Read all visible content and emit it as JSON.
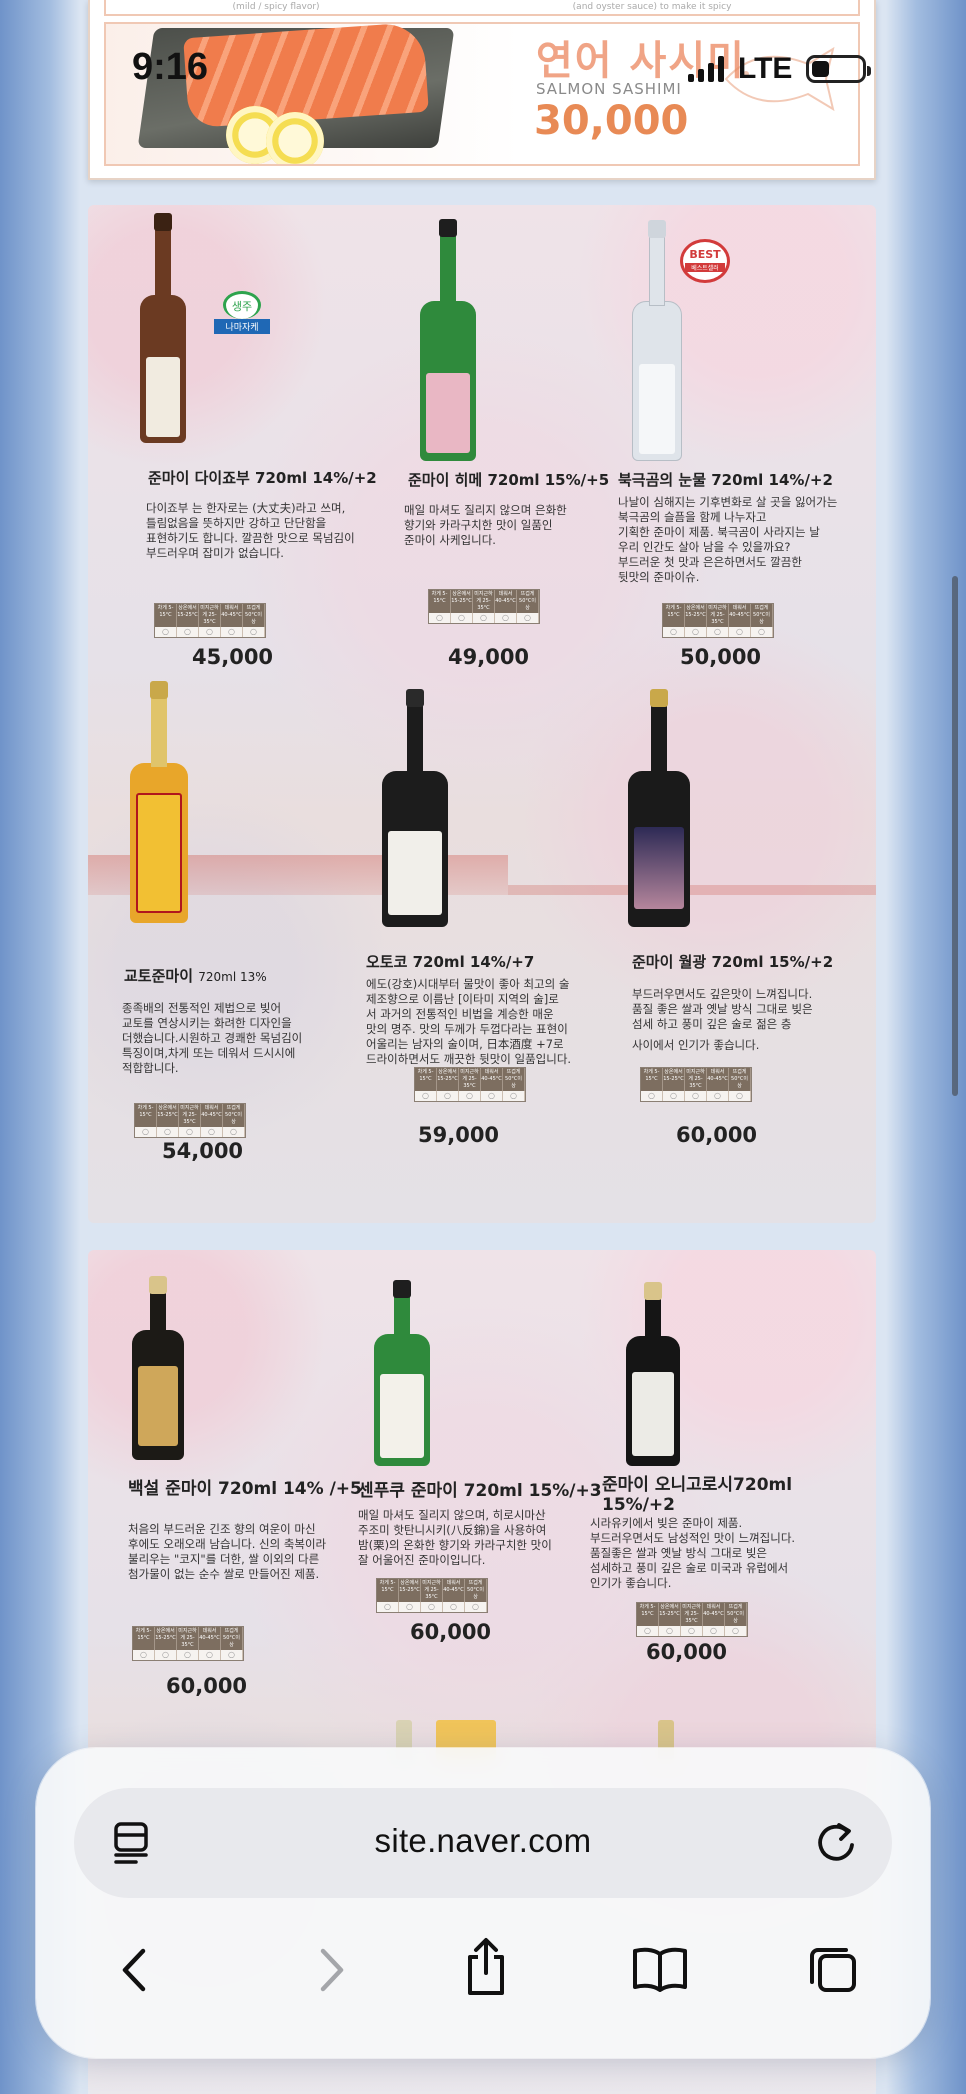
{
  "status_bar": {
    "time": "9:16",
    "network": "LTE",
    "battery_level": 0.34
  },
  "top_banner": {
    "prev_strip_left": "(mild / spicy flavor)",
    "prev_strip_right": "(and oyster sauce) to make it spicy",
    "title_kr": "연어 사시미",
    "title_en": "SALMON SASHIMI",
    "price": "30,000"
  },
  "temperature_headers": [
    "차게 5-15°C",
    "상온에서 15-25°C",
    "미지근하게 25-35°C",
    "데워서 40-45°C",
    "뜨겁게 50°C이상"
  ],
  "panel1": {
    "products": [
      {
        "name": "준마이 다이죠부 720ml 14%/+2",
        "desc": [
          "다이죠부 는 한자로는 (大丈夫)라고 쓰며,",
          "틀림없음을 뜻하지만 강하고 단단함을",
          "표현하기도 합니다. 깔끔한 맛으로 목넘김이",
          "부드러우며 잡미가 없습니다."
        ],
        "price": "45,000",
        "badge": "생주",
        "badge_ribbon": "나마자케",
        "bottle_color": "#6b3a22"
      },
      {
        "name": "준마이 히메 720ml 15%/+5",
        "desc": [
          "매일 마셔도 질리지 않으며 은화한",
          "향기와 카라구치한 맛이 일품인",
          "준마이 사케입니다."
        ],
        "price": "49,000",
        "bottle_color": "#2f8a3c"
      },
      {
        "name": "북극곰의 눈물 720ml 14%/+2",
        "desc": [
          "나날이 심해지는 기후변화로 살 곳을 잃어가는",
          "북극곰의 슬픔을 함께 나누자고",
          "기획한 준마이 제품. 북극곰이 사라지는 날",
          "우리 인간도 살아 남을 수 있을까요?",
          "부드러운 첫 맛과 은은하면서도 깔끔한",
          "뒷맛의 준마이슈."
        ],
        "price": "50,000",
        "badge": "BEST",
        "badge_ribbon": "베스트셀러",
        "bottle_color": "#dfe4ea"
      },
      {
        "name": "교토준마이",
        "name_small": "720ml 13%",
        "desc": [
          "종족배의 전통적인 제법으로 빚어",
          "교토를 연상시키는 화려한 디자인을",
          "더했습니다.시원하고 경쾌한 목넘김이",
          "특징이며,차게 또는 데워서 드시시에",
          "적합합니다."
        ],
        "price": "54,000",
        "bottle_color": "#e8a62a"
      },
      {
        "name": "오토코 720ml 14%/+7",
        "desc": [
          "에도(강호)시대부터 물맛이 좋아 최고의 술",
          "제조향으로 이름난 [이타미 지역의 술]로",
          "서 과거의 전통적인 비법을 계승한 매운",
          "맛의 명주. 맛의 두께가 두껍다라는 표현이",
          "어울리는 남자의 술이며, 日本酒度 +7로",
          "드라이하면서도 깨끗한 뒷맛이 일품입니다."
        ],
        "price": "59,000",
        "bottle_color": "#1c1c1c"
      },
      {
        "name": "준마이 월광 720ml 15%/+2",
        "desc": [
          "부드러우면서도 깊은맛이 느껴집니다.",
          "품질 좋은 쌀과 옛날 방식 그대로 빚은",
          "섬세 하고 풍미 깊은 술로 젊은 층",
          "",
          "사이에서 인기가 좋습니다."
        ],
        "price": "60,000",
        "bottle_color": "#1a1a1a"
      }
    ]
  },
  "panel2": {
    "products": [
      {
        "name": "백설 준마이 720ml 14% /+5",
        "desc": [
          "처음의 부드러운 긴조 향의 여운이 마신",
          "후에도 오래오래 남습니다. 신의 축복이라",
          "불리우는 \"코지\"를 더한, 쌀 이외의 다른",
          "첨가물이 없는 순수 쌀로 만들어진 제품."
        ],
        "price": "60,000",
        "bottle_color": "#1c1a16"
      },
      {
        "name": "센푸쿠 준마이 720ml 15%/+3",
        "desc": [
          "매일 마셔도 질리지 않으며, 히로시마산",
          "주조미 핫탄니시키(八反錦)을 사용하여",
          "밤(栗)의 온화한 향기와 카라구치한 맛이",
          "잘 어울어진 준마이입니다."
        ],
        "price": "60,000",
        "bottle_color": "#2f8a3c"
      },
      {
        "name": "준마이 오니고로시720ml 15%/+2",
        "desc": [
          "시라유키에서 빚은 준마이 제품.",
          "부드러우면서도 남성적인 맛이 느껴집니다.",
          "품질좋은 쌀과 옛날 방식 그대로 빚은",
          "섬세하고 풍미 깊은 술로 미국과 유럽에서",
          "인기가 좋습니다."
        ],
        "price": "60,000",
        "bottle_color": "#151515"
      }
    ]
  },
  "browser": {
    "url": "site.naver.com",
    "icons": [
      "reader-menu-icon",
      "reload-icon",
      "back-icon",
      "forward-icon",
      "share-icon",
      "bookmarks-icon",
      "tabs-icon"
    ]
  }
}
